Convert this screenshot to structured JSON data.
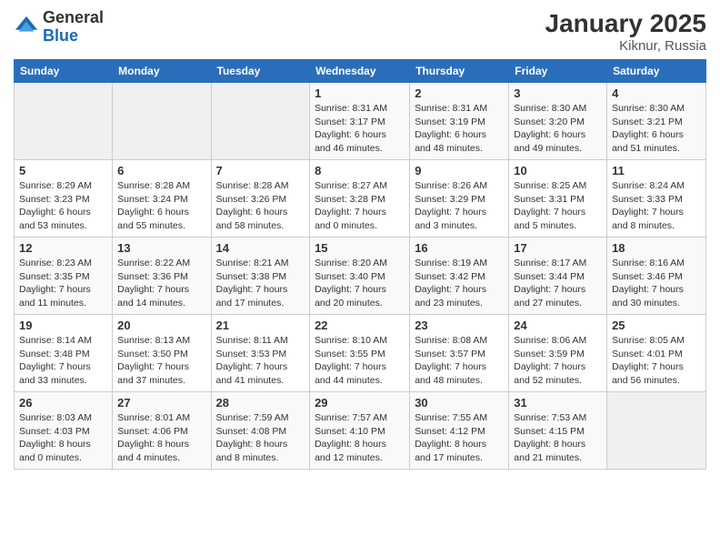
{
  "app": {
    "logo_general": "General",
    "logo_blue": "Blue",
    "month_title": "January 2025",
    "location": "Kiknur, Russia"
  },
  "calendar": {
    "headers": [
      "Sunday",
      "Monday",
      "Tuesday",
      "Wednesday",
      "Thursday",
      "Friday",
      "Saturday"
    ],
    "weeks": [
      [
        {
          "day": "",
          "info": ""
        },
        {
          "day": "",
          "info": ""
        },
        {
          "day": "",
          "info": ""
        },
        {
          "day": "1",
          "info": "Sunrise: 8:31 AM\nSunset: 3:17 PM\nDaylight: 6 hours\nand 46 minutes."
        },
        {
          "day": "2",
          "info": "Sunrise: 8:31 AM\nSunset: 3:19 PM\nDaylight: 6 hours\nand 48 minutes."
        },
        {
          "day": "3",
          "info": "Sunrise: 8:30 AM\nSunset: 3:20 PM\nDaylight: 6 hours\nand 49 minutes."
        },
        {
          "day": "4",
          "info": "Sunrise: 8:30 AM\nSunset: 3:21 PM\nDaylight: 6 hours\nand 51 minutes."
        }
      ],
      [
        {
          "day": "5",
          "info": "Sunrise: 8:29 AM\nSunset: 3:23 PM\nDaylight: 6 hours\nand 53 minutes."
        },
        {
          "day": "6",
          "info": "Sunrise: 8:28 AM\nSunset: 3:24 PM\nDaylight: 6 hours\nand 55 minutes."
        },
        {
          "day": "7",
          "info": "Sunrise: 8:28 AM\nSunset: 3:26 PM\nDaylight: 6 hours\nand 58 minutes."
        },
        {
          "day": "8",
          "info": "Sunrise: 8:27 AM\nSunset: 3:28 PM\nDaylight: 7 hours\nand 0 minutes."
        },
        {
          "day": "9",
          "info": "Sunrise: 8:26 AM\nSunset: 3:29 PM\nDaylight: 7 hours\nand 3 minutes."
        },
        {
          "day": "10",
          "info": "Sunrise: 8:25 AM\nSunset: 3:31 PM\nDaylight: 7 hours\nand 5 minutes."
        },
        {
          "day": "11",
          "info": "Sunrise: 8:24 AM\nSunset: 3:33 PM\nDaylight: 7 hours\nand 8 minutes."
        }
      ],
      [
        {
          "day": "12",
          "info": "Sunrise: 8:23 AM\nSunset: 3:35 PM\nDaylight: 7 hours\nand 11 minutes."
        },
        {
          "day": "13",
          "info": "Sunrise: 8:22 AM\nSunset: 3:36 PM\nDaylight: 7 hours\nand 14 minutes."
        },
        {
          "day": "14",
          "info": "Sunrise: 8:21 AM\nSunset: 3:38 PM\nDaylight: 7 hours\nand 17 minutes."
        },
        {
          "day": "15",
          "info": "Sunrise: 8:20 AM\nSunset: 3:40 PM\nDaylight: 7 hours\nand 20 minutes."
        },
        {
          "day": "16",
          "info": "Sunrise: 8:19 AM\nSunset: 3:42 PM\nDaylight: 7 hours\nand 23 minutes."
        },
        {
          "day": "17",
          "info": "Sunrise: 8:17 AM\nSunset: 3:44 PM\nDaylight: 7 hours\nand 27 minutes."
        },
        {
          "day": "18",
          "info": "Sunrise: 8:16 AM\nSunset: 3:46 PM\nDaylight: 7 hours\nand 30 minutes."
        }
      ],
      [
        {
          "day": "19",
          "info": "Sunrise: 8:14 AM\nSunset: 3:48 PM\nDaylight: 7 hours\nand 33 minutes."
        },
        {
          "day": "20",
          "info": "Sunrise: 8:13 AM\nSunset: 3:50 PM\nDaylight: 7 hours\nand 37 minutes."
        },
        {
          "day": "21",
          "info": "Sunrise: 8:11 AM\nSunset: 3:53 PM\nDaylight: 7 hours\nand 41 minutes."
        },
        {
          "day": "22",
          "info": "Sunrise: 8:10 AM\nSunset: 3:55 PM\nDaylight: 7 hours\nand 44 minutes."
        },
        {
          "day": "23",
          "info": "Sunrise: 8:08 AM\nSunset: 3:57 PM\nDaylight: 7 hours\nand 48 minutes."
        },
        {
          "day": "24",
          "info": "Sunrise: 8:06 AM\nSunset: 3:59 PM\nDaylight: 7 hours\nand 52 minutes."
        },
        {
          "day": "25",
          "info": "Sunrise: 8:05 AM\nSunset: 4:01 PM\nDaylight: 7 hours\nand 56 minutes."
        }
      ],
      [
        {
          "day": "26",
          "info": "Sunrise: 8:03 AM\nSunset: 4:03 PM\nDaylight: 8 hours\nand 0 minutes."
        },
        {
          "day": "27",
          "info": "Sunrise: 8:01 AM\nSunset: 4:06 PM\nDaylight: 8 hours\nand 4 minutes."
        },
        {
          "day": "28",
          "info": "Sunrise: 7:59 AM\nSunset: 4:08 PM\nDaylight: 8 hours\nand 8 minutes."
        },
        {
          "day": "29",
          "info": "Sunrise: 7:57 AM\nSunset: 4:10 PM\nDaylight: 8 hours\nand 12 minutes."
        },
        {
          "day": "30",
          "info": "Sunrise: 7:55 AM\nSunset: 4:12 PM\nDaylight: 8 hours\nand 17 minutes."
        },
        {
          "day": "31",
          "info": "Sunrise: 7:53 AM\nSunset: 4:15 PM\nDaylight: 8 hours\nand 21 minutes."
        },
        {
          "day": "",
          "info": ""
        }
      ]
    ]
  }
}
